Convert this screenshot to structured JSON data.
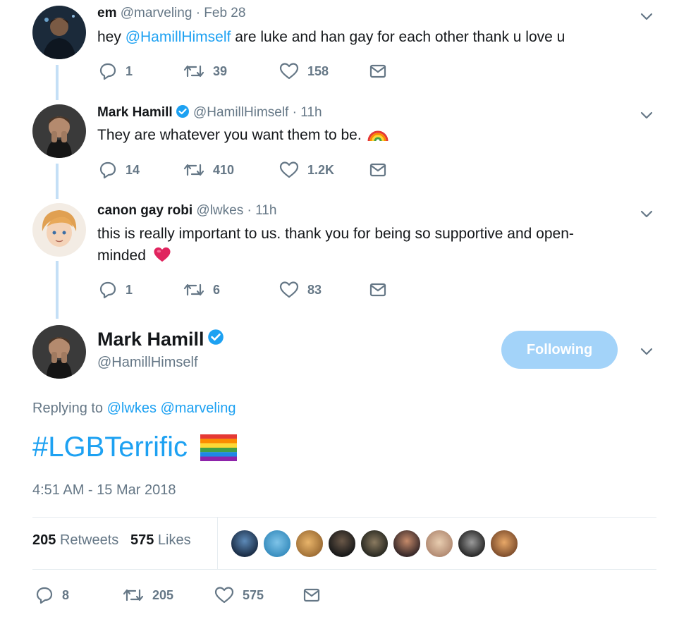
{
  "tweets": [
    {
      "name": "em",
      "handle": "@marveling",
      "time": "· Feb 28",
      "text_before": "hey ",
      "mention": "@HamillHimself",
      "text_after": " are luke and han gay for each other thank u love u",
      "replies": "1",
      "retweets": "39",
      "likes": "158"
    },
    {
      "name": "Mark Hamill",
      "handle": "@HamillHimself",
      "time": "· 11h",
      "text": "They are whatever you want them to be.",
      "emoji": "rainbow",
      "replies": "14",
      "retweets": "410",
      "likes": "1.2K"
    },
    {
      "name": "canon gay robi",
      "handle": "@lwkes",
      "time": "· 11h",
      "text": "this is really important to us. thank you for being so supportive and open-minded",
      "emoji": "heart",
      "replies": "1",
      "retweets": "6",
      "likes": "83"
    }
  ],
  "main_tweet": {
    "name": "Mark Hamill",
    "handle": "@HamillHimself",
    "follow_label": "Following",
    "replying_label": "Replying to",
    "replying_to": [
      "@lwkes",
      "@marveling"
    ],
    "hashtag": "#LGBTerrific",
    "timestamp": "4:51 AM - 15 Mar 2018",
    "retweets_count": "205",
    "retweets_label": "Retweets",
    "likes_count": "575",
    "likes_label": "Likes",
    "action_replies": "8",
    "action_retweets": "205",
    "action_likes": "575"
  },
  "colors": {
    "link": "#1da1f2",
    "follow_button": "#a3d3f9",
    "thread_line": "#c4dff6",
    "muted": "#657786",
    "verified": "#1da1f2"
  },
  "icons": [
    "reply-icon",
    "retweet-icon",
    "like-icon",
    "dm-icon",
    "chevron-down-icon",
    "verified-icon",
    "rainbow-emoji",
    "heart-emoji",
    "rainbow-flag-emoji"
  ]
}
